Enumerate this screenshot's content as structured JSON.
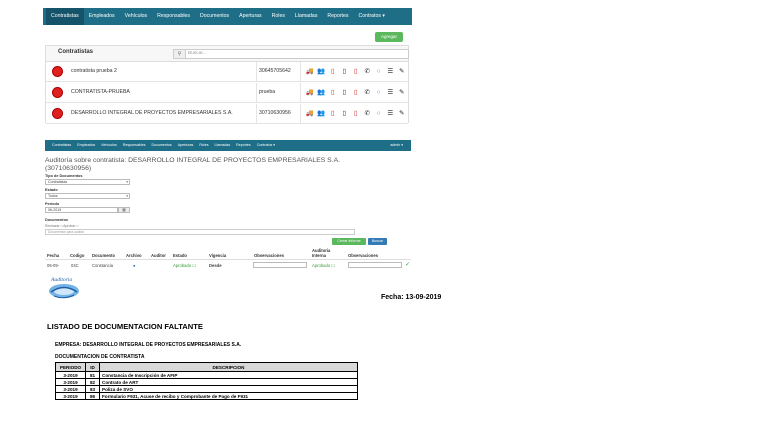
{
  "panel1": {
    "nav": [
      "Contratistas",
      "Empleados",
      "Vehículos",
      "Responsables",
      "Documentos",
      "Aperturas",
      "Roles",
      "Llamadas",
      "Reportes",
      "Contratos ▾"
    ],
    "add_button": "Agregar",
    "grid_title": "Contratistas",
    "search_placeholder": "Buscar...",
    "rows": [
      {
        "name": "contratista prueba 2",
        "code": "30645705642"
      },
      {
        "name": "CONTRATISTA-PRUEBA",
        "code": "prueba"
      },
      {
        "name": "DESARROLLO INTEGRAL DE PROYECTOS EMPRESARIALES S.A.",
        "code": "30710630956"
      }
    ],
    "row_icons": [
      "truck-icon",
      "users-icon",
      "pdf-icon",
      "document-icon",
      "pdf-icon",
      "phone-icon",
      "circle-icon",
      "list-icon",
      "pencil-icon"
    ]
  },
  "panel2": {
    "nav": [
      "Contratistas",
      "Empleados",
      "Vehículos",
      "Responsables",
      "Documentos",
      "Aperturas",
      "Roles",
      "Llamadas",
      "Reportes",
      "Contratos ▾"
    ],
    "user": "admin ▾",
    "title_line1": "Auditoría sobre contratista: DESARROLLO INTEGRAL DE PROYECTOS EMPRESARIALES S.A.",
    "title_line2": "(30710630956)",
    "tipo_label": "Tipo de Documentos",
    "tipo_value": "Contratistas",
    "estado_label": "Estado",
    "estado_value": "Todos",
    "periodo_label": "Período",
    "periodo_value": "06-2019",
    "documentos_label": "Documentos",
    "documentos_hint": "Rechazar □   Aprobar □",
    "documentos_placeholder": "Documentos para auditar",
    "btn_green": "Cerrar informe",
    "btn_blue": "Buscar",
    "headers": [
      "Fecha",
      "Codigo",
      "Documento",
      "Archivo",
      "Auditor",
      "Estado",
      "Vigencia",
      "Observaciones",
      "Auditoria Interna",
      "Observaciones"
    ],
    "row": {
      "fecha": "06-09-",
      "codigo": "04C",
      "documento": "Constancia",
      "estado": "Aprobado ☐",
      "vigencia": "Desde",
      "auditoria": "Aprobado ☐"
    }
  },
  "report": {
    "date": "Fecha: 13-09-2019",
    "title": "LISTADO DE DOCUMENTACION FALTANTE",
    "empresa": "EMPRESA: DESARROLLO INTEGRAL DE PROYECTOS EMPRESARIALES S.A.",
    "section": "DOCUMENTACION DE CONTRATISTA",
    "columns": [
      "PERIODO",
      "ID",
      "DESCRIPCION"
    ],
    "rows": [
      {
        "periodo": "3-2019",
        "id": "81",
        "desc": "Constancia de Inscripción de AFIP"
      },
      {
        "periodo": "3-2019",
        "id": "82",
        "desc": "Contrato de ART"
      },
      {
        "periodo": "3-2019",
        "id": "83",
        "desc": "Poliza de SVO"
      },
      {
        "periodo": "3-2019",
        "id": "86",
        "desc": "Formulario F931, Acuse de recibo y Comprobante de Pago de F931"
      }
    ]
  },
  "colors": {
    "nav": "#1f6e87",
    "active": "#14536a",
    "green": "#5cb85c",
    "blue": "#337ab7",
    "red_dot": "#e02020"
  }
}
